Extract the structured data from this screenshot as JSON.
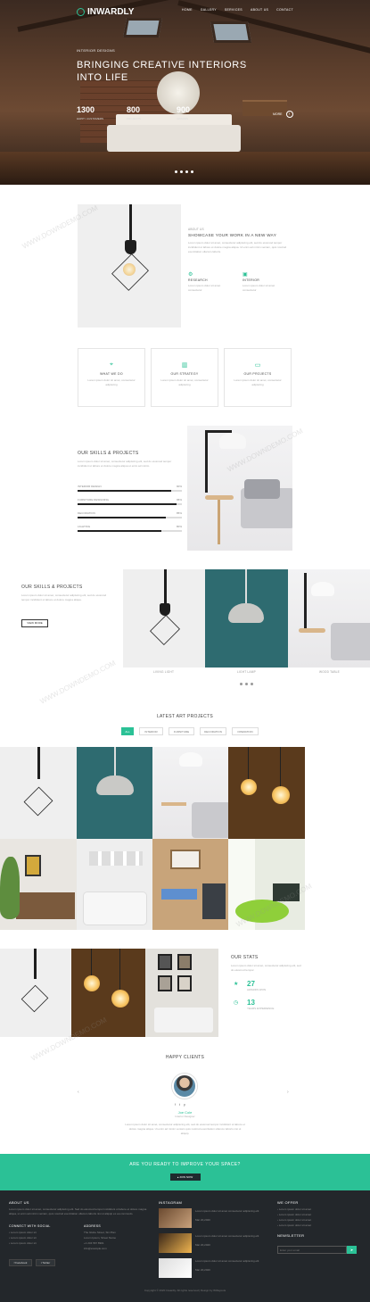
{
  "header": {
    "brand": "INWARDLY",
    "nav": [
      "HOME",
      "GALLERY",
      "SERVICES",
      "ABOUT US",
      "CONTACT"
    ]
  },
  "hero": {
    "subtitle": "INTERIOR DESIGNS",
    "title_line1": "BRINGING CREATIVE INTERIORS",
    "title_line2": "INTO LIFE",
    "stats": [
      {
        "value": "1300",
        "label": "HAPPY CUSTOMERS"
      },
      {
        "value": "800",
        "label": "PROJECTS"
      },
      {
        "value": "900",
        "label": "AWARDS"
      }
    ],
    "more": "MORE",
    "slide_count": 4,
    "active_slide": 1
  },
  "about": {
    "eyebrow": "ABOUT US",
    "title": "SHOWCASE YOUR WORK IN A NEW WAY",
    "body": "Lorem ipsum dolor sit amet, consectetur adipiscing elit, sed do eiusmod tempor incididunt ut labore et dolore magna aliqua. Ut enim ad minim veniam, quis nostrud exercitation ullamco laboris.",
    "features": [
      {
        "title": "RESEARCH",
        "text": "Lorem ipsum dolor sit amet consectetur"
      },
      {
        "title": "INTERIOR",
        "text": "Lorem ipsum dolor sit amet consectetur"
      }
    ]
  },
  "services": [
    {
      "title": "WHAT WE DO",
      "text": "Lorem ipsum dolor sit amet, consectetur adipiscing"
    },
    {
      "title": "OUR STRATEGY",
      "text": "Lorem ipsum dolor sit amet, consectetur adipiscing"
    },
    {
      "title": "OUR PROJECTS",
      "text": "Lorem ipsum dolor sit amet, consectetur adipiscing"
    }
  ],
  "skills": {
    "title": "OUR SKILLS & PROJECTS",
    "body": "Lorem ipsum dolor sit amet, consectetur adipiscing elit, sed do eiusmod tempor incididunt ut labore et dolore magna aliqua ut enim ad minim.",
    "bars": [
      {
        "label": "INTERIOR DESIGN",
        "value": "90%",
        "fraction": 0.9
      },
      {
        "label": "FURNITURE DESIGNING",
        "value": "95%",
        "fraction": 0.95
      },
      {
        "label": "DECORATION",
        "value": "85%",
        "fraction": 0.85
      },
      {
        "label": "LIGHTING",
        "value": "80%",
        "fraction": 0.8
      }
    ]
  },
  "gallery_strip": {
    "title": "OUR SKILLS & PROJECTS",
    "body": "Lorem ipsum dolor sit amet, consectetur adipiscing elit, sed do eiusmod tempor incididunt ut labore et dolore magna aliqua.",
    "button": "VIEW MORE",
    "captions": [
      "LIVING LIGHT",
      "LIGHT LAMP",
      "WOOD TABLE"
    ]
  },
  "latest": {
    "title": "LATEST ART PROJECTS",
    "tabs": [
      "ALL",
      "INTERIOR",
      "FURNITURE",
      "DECORATION",
      "OPERATION"
    ],
    "active": "ALL"
  },
  "stats": {
    "title": "OUR STATS",
    "body": "Lorem ipsum dolor sit amet, consectetur adipiscing elit, sed do eiusmod tempor.",
    "items": [
      {
        "value": "27",
        "label": "AWARDS WON"
      },
      {
        "value": "13",
        "label": "YEARS EXPERIENCE"
      }
    ]
  },
  "clients": {
    "title": "HAPPY CLIENTS",
    "name": "Joe Cole",
    "role": "Interior Designer",
    "quote": "Lorem ipsum dolor sit amet, consectetur adipiscing elit, sed do eiusmod tempor incididunt ut labore et dolore magna aliqua. Ut enim ad minim veniam quis nostrud exercitation ullamco laboris nisi ut aliquip."
  },
  "cta": {
    "title": "ARE YOU READY TO IMPROVE YOUR SPACE?",
    "button": "JOIN NOW"
  },
  "footer": {
    "about_title": "ABOUT US",
    "about_text": "Lorem ipsum dolor sit amet, consectetur adipiscing elit. Sed do eiusmod tempor incididunt ut labore et dolore magna aliqua, ut enim ad minim veniam, quis nostrud exercitation ullamco laboris nisi ut aliquip ex ea commodo.",
    "connect_title": "CONNECT WITH SOCIAL",
    "connect_lines": [
      "Lorem ipsum dolor sit",
      "Lorem ipsum dolor sit",
      "Lorem ipsum dolor sit"
    ],
    "address_title": "ADDRESS",
    "address_lines": [
      "The Globe Street, Sin Plan",
      "Lorem Ipsum, Street Name",
      "+1 234 567 8901",
      "info@example.com"
    ],
    "social": [
      "Facebook",
      "Twitter"
    ],
    "instagram_title": "INSTAGRAM",
    "insta_posts": [
      {
        "text": "Lorem ipsum dolor sit amet consectetur adipiscing elit",
        "date": "Mar 20,2020"
      },
      {
        "text": "Lorem ipsum dolor sit amet consectetur adipiscing elit",
        "date": "Mar 20,2020"
      },
      {
        "text": "Lorem ipsum dolor sit amet consectetur adipiscing elit",
        "date": "Mar 20,2020"
      }
    ],
    "offers_title": "WE OFFER",
    "offers": [
      "Lorem ipsum dolor sit amet",
      "Lorem ipsum dolor sit amet",
      "Lorem ipsum dolor sit amet",
      "Lorem ipsum dolor sit amet"
    ],
    "newsletter_title": "NEWSLETTER",
    "newsletter_placeholder": "Enter your email",
    "copyright": "Copyright © 2020 Inwardly. All rights reserved | Design by W3layouts"
  },
  "watermark": "WWW.DOWNDEMO.COM",
  "colors": {
    "accent": "#2bc196",
    "footer_bg": "#23272b",
    "hero_bg": "#4a3222"
  }
}
